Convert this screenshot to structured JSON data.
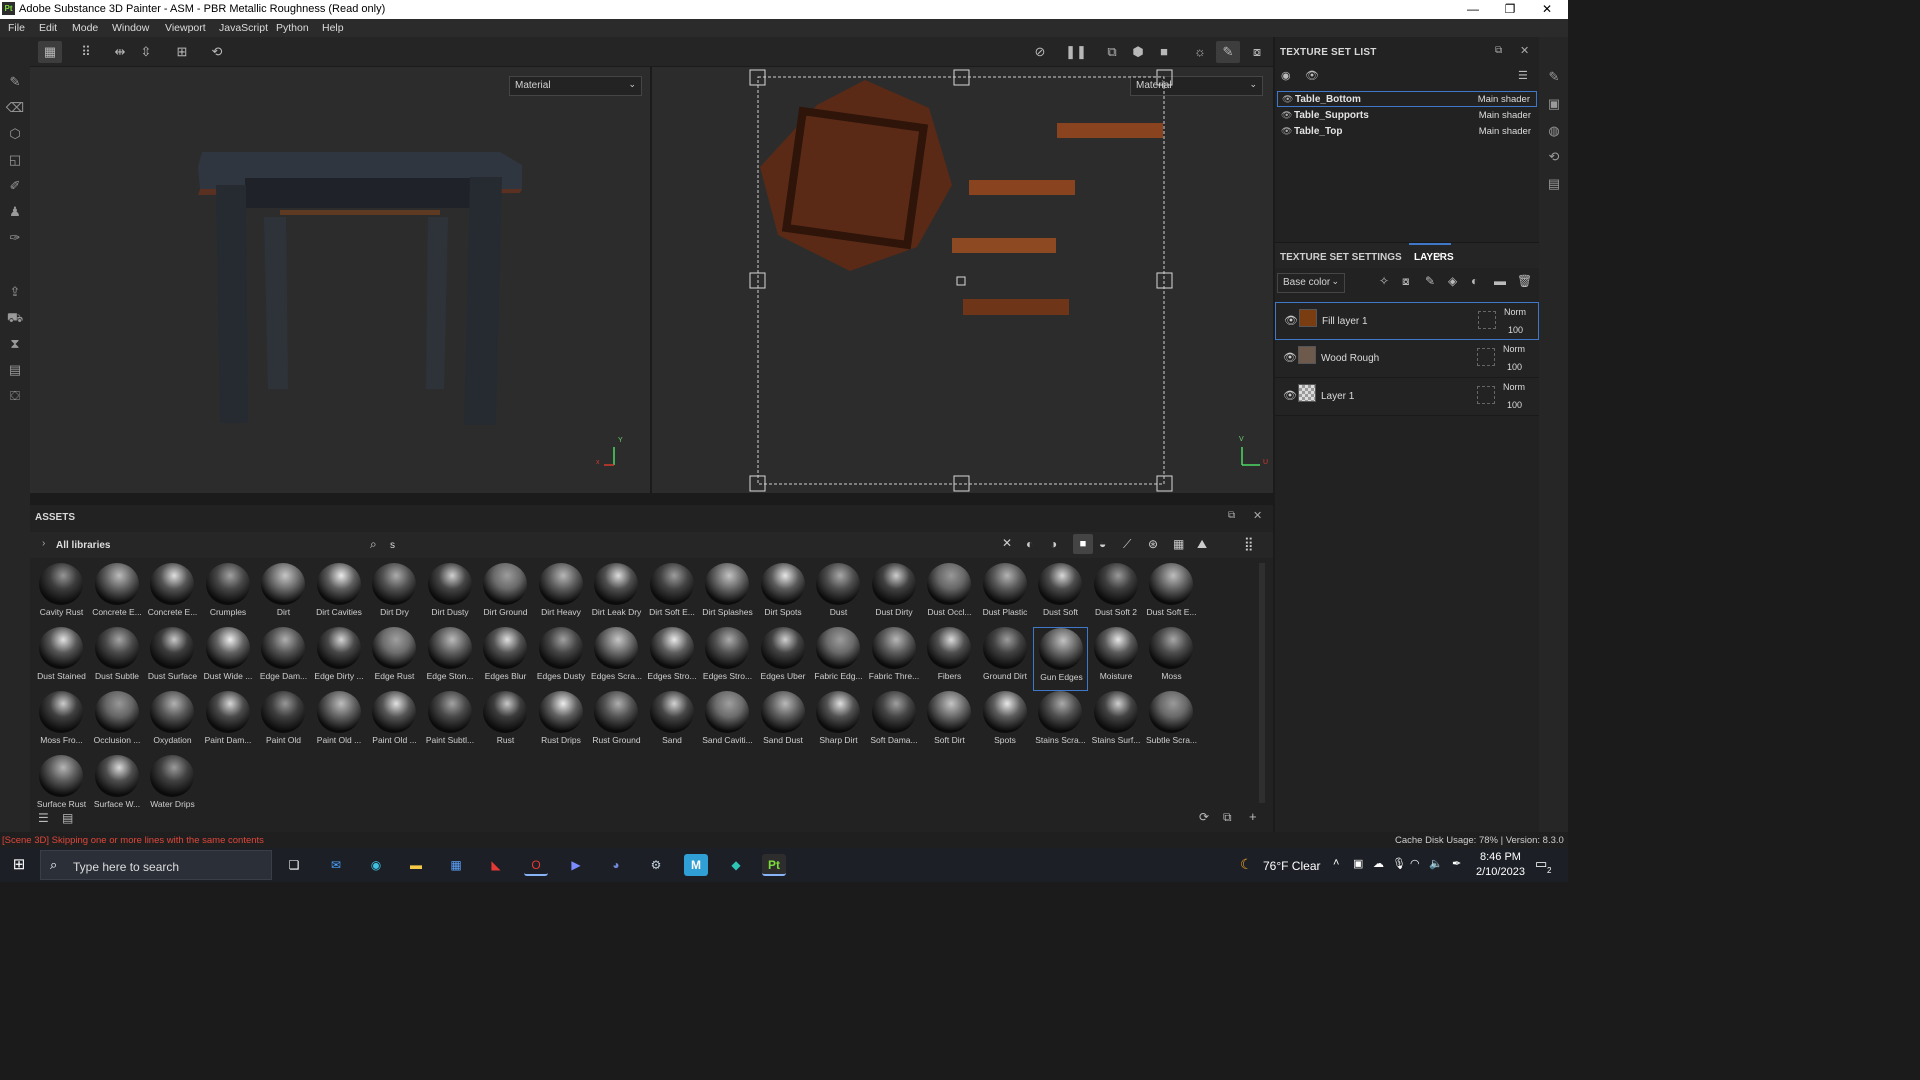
{
  "window": {
    "title": "Adobe Substance 3D Painter - ASM - PBR Metallic Roughness (Read only)",
    "logo": "Pt",
    "controls": [
      "—",
      "❐",
      "✕"
    ]
  },
  "menu": [
    "File",
    "Edit",
    "Mode",
    "Window",
    "Viewport",
    "JavaScript",
    "Python",
    "Help"
  ],
  "viewport3d": {
    "dropdown": "Material",
    "axis_y": "Y",
    "axis_x": "x"
  },
  "viewport2d": {
    "dropdown": "Material",
    "axis_v": "V",
    "axis_u": "U"
  },
  "texture_set_list": {
    "title": "TEXTURE SET LIST",
    "items": [
      {
        "name": "Table_Bottom",
        "shader": "Main shader"
      },
      {
        "name": "Table_Supports",
        "shader": "Main shader"
      },
      {
        "name": "Table_Top",
        "shader": "Main shader"
      }
    ]
  },
  "layers_panel": {
    "tab_settings": "TEXTURE SET SETTINGS",
    "tab_layers": "LAYERS",
    "channel": "Base color",
    "layers": [
      {
        "name": "Fill layer 1",
        "blend": "Norm",
        "opacity": "100",
        "thumb_color": "#7a3d12"
      },
      {
        "name": "Wood Rough",
        "blend": "Norm",
        "opacity": "100",
        "thumb_color": "#6e5a4d"
      },
      {
        "name": "Layer 1",
        "blend": "Norm",
        "opacity": "100",
        "thumb_color": "checker"
      }
    ]
  },
  "assets": {
    "title": "ASSETS",
    "library": "All libraries",
    "search_value": "s",
    "items": [
      "Cavity Rust",
      "Concrete E...",
      "Concrete E...",
      "Crumples",
      "Dirt",
      "Dirt Cavities",
      "Dirt Dry",
      "Dirt Dusty",
      "Dirt Ground",
      "Dirt Heavy",
      "Dirt Leak Dry",
      "Dirt Soft E...",
      "Dirt Splashes",
      "Dirt Spots",
      "Dust",
      "Dust Dirty",
      "Dust Occl...",
      "Dust Plastic",
      "Dust Soft",
      "Dust Soft 2",
      "Dust Soft E...",
      "Dust Stained",
      "Dust Subtle",
      "Dust Surface",
      "Dust Wide ...",
      "Edge Dam...",
      "Edge Dirty ...",
      "Edge Rust",
      "Edge Ston...",
      "Edges Blur",
      "Edges Dusty",
      "Edges Scra...",
      "Edges Stro...",
      "Edges Stro...",
      "Edges Uber",
      "Fabric Edg...",
      "Fabric Thre...",
      "Fibers",
      "Ground Dirt",
      "Gun Edges",
      "Moisture",
      "Moss",
      "Moss Fro...",
      "Occlusion ...",
      "Oxydation",
      "Paint Dam...",
      "Paint Old",
      "Paint Old ...",
      "Paint Old ...",
      "Paint Subtl...",
      "Rust",
      "Rust Drips",
      "Rust Ground",
      "Sand",
      "Sand Caviti...",
      "Sand Dust",
      "Sharp Dirt",
      "Soft Dama...",
      "Soft Dirt",
      "Spots",
      "Stains Scra...",
      "Stains Surf...",
      "Subtle Scra...",
      "Surface Rust",
      "Surface W...",
      "Water Drips"
    ],
    "selected": "Gun Edges"
  },
  "status": {
    "message": "[Scene 3D] Skipping one or more lines with the same contents",
    "cache": "Cache Disk Usage:  78% | Version: 8.3.0"
  },
  "taskbar": {
    "search_placeholder": "Type here to search",
    "weather": "76°F  Clear",
    "time": "8:46 PM",
    "date": "2/10/2023",
    "notification_count": "2"
  },
  "colors": {
    "accent": "#3f78c9",
    "wood": "#6a2f17",
    "status_error": "#e0463a"
  }
}
